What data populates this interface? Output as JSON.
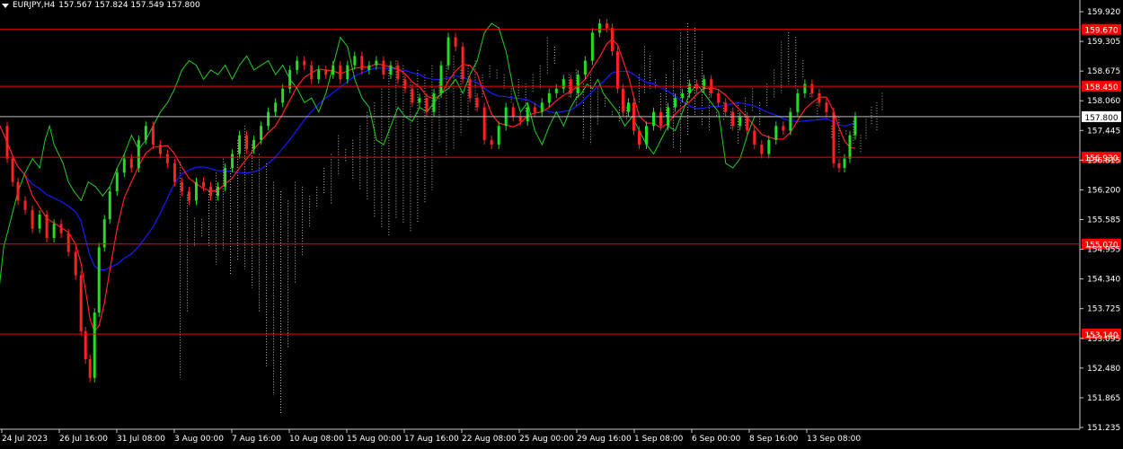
{
  "header": {
    "symbol": "EURJPY,H4",
    "ohlc": "157.567 157.824 157.549 157.800"
  },
  "chart_data": {
    "type": "candlestick",
    "instrument": "EURJPY",
    "timeframe": "H4",
    "ylim": [
      151.1,
      160.3
    ],
    "y_ticks": [
      "159.920",
      "159.305",
      "158.675",
      "158.060",
      "157.445",
      "156.815",
      "156.200",
      "155.585",
      "154.955",
      "154.340",
      "153.725",
      "153.095",
      "152.480",
      "151.865",
      "151.235"
    ],
    "x_ticks": [
      "24 Jul 2023",
      "26 Jul 16:00",
      "31 Jul 08:00",
      "3 Aug 00:00",
      "7 Aug 16:00",
      "10 Aug 08:00",
      "15 Aug 00:00",
      "17 Aug 16:00",
      "22 Aug 08:00",
      "25 Aug 00:00",
      "29 Aug 16:00",
      "1 Sep 08:00",
      "6 Sep 00:00",
      "8 Sep 16:00",
      "13 Sep 08:00"
    ],
    "horizontal_levels": [
      {
        "value": 159.67,
        "label": "159.670",
        "color": "#ff0000"
      },
      {
        "value": 158.45,
        "label": "158.450",
        "color": "#ff0000"
      },
      {
        "value": 156.93,
        "label": "156.930",
        "color": "#ff0000"
      },
      {
        "value": 155.07,
        "label": "155.070",
        "color": "#ff0000"
      },
      {
        "value": 153.14,
        "label": "153.140",
        "color": "#ff0000"
      }
    ],
    "current_price": {
      "value": 157.8,
      "label": "157.800"
    },
    "candles_close_path": [
      [
        0,
        157.6
      ],
      [
        8,
        156.9
      ],
      [
        14,
        156.4
      ],
      [
        20,
        156.0
      ],
      [
        28,
        155.8
      ],
      [
        36,
        155.4
      ],
      [
        44,
        155.7
      ],
      [
        52,
        155.2
      ],
      [
        60,
        155.5
      ],
      [
        68,
        155.3
      ],
      [
        76,
        154.9
      ],
      [
        84,
        154.4
      ],
      [
        90,
        153.2
      ],
      [
        95,
        152.6
      ],
      [
        100,
        152.2
      ],
      [
        105,
        153.6
      ],
      [
        110,
        155.0
      ],
      [
        116,
        155.6
      ],
      [
        122,
        156.2
      ],
      [
        130,
        156.6
      ],
      [
        138,
        156.9
      ],
      [
        146,
        156.7
      ],
      [
        154,
        157.3
      ],
      [
        162,
        157.6
      ],
      [
        170,
        157.2
      ],
      [
        178,
        157.0
      ],
      [
        186,
        156.8
      ],
      [
        194,
        156.4
      ],
      [
        202,
        156.2
      ],
      [
        210,
        156.0
      ],
      [
        218,
        156.4
      ],
      [
        226,
        156.3
      ],
      [
        234,
        156.1
      ],
      [
        242,
        156.3
      ],
      [
        250,
        156.7
      ],
      [
        258,
        157.0
      ],
      [
        266,
        157.4
      ],
      [
        274,
        157.1
      ],
      [
        282,
        157.3
      ],
      [
        290,
        157.6
      ],
      [
        298,
        157.9
      ],
      [
        306,
        158.1
      ],
      [
        314,
        158.4
      ],
      [
        322,
        158.8
      ],
      [
        330,
        159.0
      ],
      [
        338,
        158.9
      ],
      [
        346,
        158.6
      ],
      [
        354,
        158.8
      ],
      [
        362,
        158.7
      ],
      [
        370,
        158.9
      ],
      [
        378,
        158.6
      ],
      [
        386,
        158.9
      ],
      [
        394,
        159.1
      ],
      [
        402,
        158.8
      ],
      [
        410,
        158.9
      ],
      [
        418,
        159.0
      ],
      [
        426,
        158.7
      ],
      [
        434,
        158.9
      ],
      [
        442,
        158.6
      ],
      [
        450,
        158.4
      ],
      [
        458,
        158.1
      ],
      [
        466,
        158.2
      ],
      [
        474,
        157.9
      ],
      [
        482,
        158.3
      ],
      [
        490,
        158.9
      ],
      [
        498,
        159.5
      ],
      [
        506,
        159.3
      ],
      [
        514,
        158.6
      ],
      [
        522,
        158.2
      ],
      [
        530,
        158.0
      ],
      [
        538,
        157.3
      ],
      [
        546,
        157.2
      ],
      [
        554,
        157.6
      ],
      [
        562,
        158.0
      ],
      [
        570,
        157.8
      ],
      [
        578,
        157.7
      ],
      [
        586,
        158.0
      ],
      [
        594,
        157.9
      ],
      [
        602,
        158.1
      ],
      [
        610,
        158.3
      ],
      [
        618,
        158.4
      ],
      [
        626,
        158.6
      ],
      [
        634,
        158.3
      ],
      [
        642,
        158.7
      ],
      [
        650,
        159.0
      ],
      [
        658,
        159.6
      ],
      [
        666,
        159.8
      ],
      [
        674,
        159.7
      ],
      [
        680,
        159.2
      ],
      [
        686,
        158.4
      ],
      [
        692,
        157.9
      ],
      [
        698,
        158.1
      ],
      [
        704,
        157.5
      ],
      [
        710,
        157.2
      ],
      [
        718,
        157.6
      ],
      [
        726,
        157.9
      ],
      [
        734,
        157.6
      ],
      [
        742,
        158.0
      ],
      [
        750,
        158.2
      ],
      [
        758,
        158.3
      ],
      [
        766,
        158.5
      ],
      [
        774,
        158.4
      ],
      [
        782,
        158.6
      ],
      [
        790,
        158.3
      ],
      [
        798,
        158.1
      ],
      [
        806,
        157.9
      ],
      [
        814,
        157.6
      ],
      [
        822,
        157.8
      ],
      [
        830,
        157.5
      ],
      [
        838,
        157.2
      ],
      [
        846,
        157.0
      ],
      [
        854,
        157.3
      ],
      [
        862,
        157.6
      ],
      [
        870,
        157.5
      ],
      [
        878,
        157.9
      ],
      [
        886,
        158.3
      ],
      [
        894,
        158.5
      ],
      [
        902,
        158.3
      ],
      [
        910,
        158.1
      ],
      [
        918,
        157.9
      ],
      [
        926,
        156.8
      ],
      [
        932,
        156.7
      ],
      [
        938,
        156.9
      ],
      [
        944,
        157.4
      ],
      [
        950,
        157.8
      ]
    ]
  }
}
